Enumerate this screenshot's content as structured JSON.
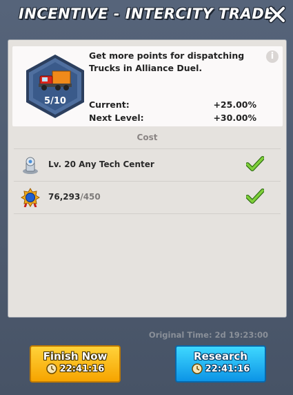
{
  "header": {
    "title": "INCENTIVE - INTERCITY TRADE",
    "close_icon": "close-icon"
  },
  "tech": {
    "level_text": "5/10",
    "description": "Get more points for dispatching Trucks in Alliance Duel.",
    "current_label": "Current:",
    "current_value": "+25.00%",
    "next_label": "Next Level:",
    "next_value": "+30.00%",
    "info_icon": "info-icon"
  },
  "cost": {
    "header": "Cost",
    "items": [
      {
        "icon": "tech-center-icon",
        "text": "Lv. 20 Any Tech Center",
        "met": true
      },
      {
        "icon": "valor-badge-icon",
        "have": "76,293",
        "need": "/450",
        "met": true
      }
    ]
  },
  "original_time": "Original Time: 2d 19:23:00",
  "buttons": {
    "finish_label": "Finish Now",
    "finish_time": "22:41:16",
    "research_label": "Research",
    "research_time": "22:41:16"
  },
  "colors": {
    "finish_button": "#f9b800",
    "research_button": "#1ab0f0",
    "hex_badge": "#3c5d8f"
  }
}
